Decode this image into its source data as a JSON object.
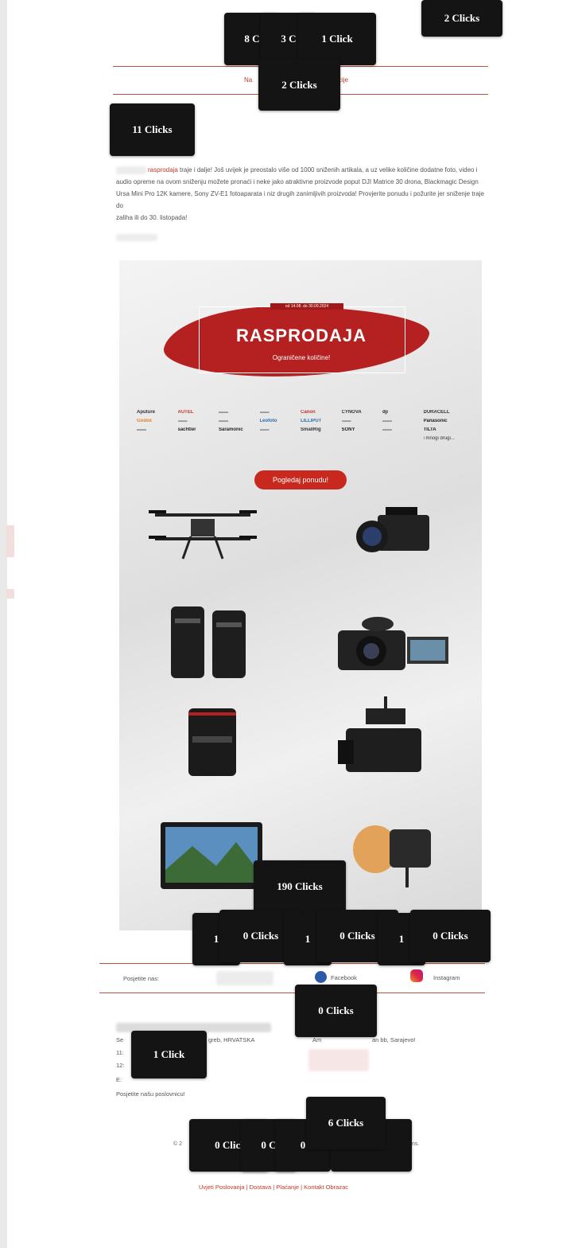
{
  "tooltips": {
    "t1": "8 C",
    "t2": "3 C",
    "t3": "1 Click",
    "t4": "2 Clicks",
    "t5": "2 Clicks",
    "t6": "11 Clicks",
    "t7": "190 Clicks",
    "t8": "1",
    "t9": "0 Clicks",
    "t10": "1",
    "t11": "0 Clicks",
    "t12": "1",
    "t13": "0 Clicks",
    "t14": "0 Clicks",
    "t15": "1 Click",
    "t16": "6 Clicks",
    "t17": "0 Clicl",
    "t18": "0 C",
    "t19": "0"
  },
  "nav": {
    "left": "Na",
    "right": "cije"
  },
  "intro": {
    "highlight": "rasprodaja",
    "text": " traje i dalje! Još uvijek je preostalo više od 1000 sniženih artikala, a uz velike količine dodatne foto, video i audio opreme na ovom sniženju možete pronaći i neke jako atraktivne proizvode poput DJI Matrice 30 drona, Blackmagic Design Ursa Mini Pro 12K kamere, Sony ZV-E1 fotoaparata i niz drugih zanimljivih proizvoda! Provjerite ponudu i požurite jer sniženje traje do ",
    "text_end": "zaliha ili do 30. listopada!"
  },
  "banner": {
    "dates": "od 14.08. do 30.09.2024",
    "title": "RASPRODAJA",
    "subtitle": "Ograničene količine!",
    "button": "Pogledaj ponudu!",
    "brands": [
      "Aputure",
      "AUTEL",
      "",
      "",
      "Canon",
      "CYNOVA",
      "dji",
      "DURACELL",
      "Godox",
      "",
      "",
      "Leofoto",
      "LILLIPUT",
      "",
      "",
      "Panasonic",
      "",
      "sachtler",
      "Saramonic",
      "",
      "SmallRig",
      "SONY",
      "",
      "TILTA"
    ],
    "brands_tail": "i mnogi drugi..."
  },
  "social": {
    "label": "Posjetite nas:",
    "facebook": "Facebook",
    "instagram": "Instagram"
  },
  "address": {
    "line1a": "Se",
    "line1b": "greb, HRVATSKA",
    "line1c": "Am",
    "line1d": "an bb, Sarajevo!",
    "line2": "11:",
    "line3": "12:",
    "line4": "E: ",
    "link": "Posjetite našu poslovnicu!"
  },
  "footer": {
    "copy_a": "© 2",
    "copy_b": "ns.",
    "links": "Uvjeti Poslovanja | Dostava | Plaćanje | Kontakt Obrazac"
  },
  "colors": {
    "accent": "#c0392b",
    "tooltip_bg": "#141414",
    "banner_red": "#b52121"
  }
}
